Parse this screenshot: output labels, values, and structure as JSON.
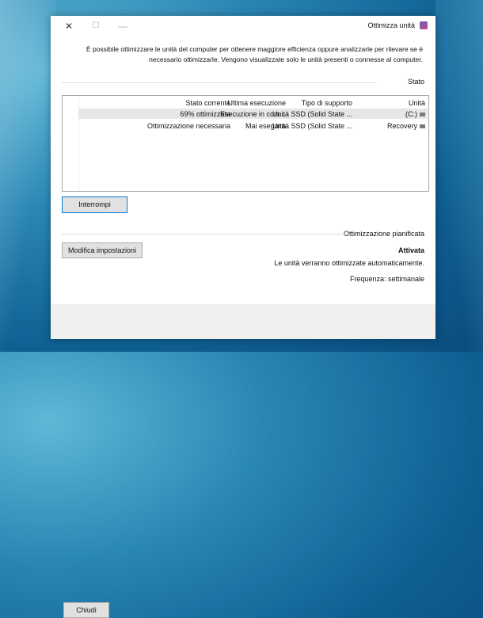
{
  "window": {
    "title": "Ottimizza unità",
    "description": "È possibile ottimizzare le unità del computer per ottenere maggiore efficienza oppure analizzarle per rilevare se è necessario ottimizzarle. Vengono visualizzate solo le unità presenti o connesse al computer."
  },
  "status_section": {
    "label": "Stato",
    "columns": [
      "Unità",
      "Tipo di supporto",
      "Ultima esecuzione",
      "Stato corrente"
    ],
    "rows": [
      {
        "unit": "(C:)",
        "type": "Unità SSD (Solid State ...",
        "last_run": "Esecuzione in cors...",
        "state": "69% ottimizzata"
      },
      {
        "unit": "Recovery",
        "type": "Unità SSD (Solid State ...",
        "last_run": "Mai eseguita",
        "state": "Ottimizzazione necessaria"
      }
    ],
    "stop_button": "Interrompi"
  },
  "scheduled": {
    "label": "Ottimizzazione pianificata",
    "status": "Attivata",
    "description": "Le unità verranno ottimizzate automaticamente.",
    "frequency": "Frequenza: settimanale",
    "settings_button": "Modifica impostazioni"
  },
  "footer": {
    "close_button": "Chiudi"
  },
  "icons": {
    "close": "close-icon",
    "maximize": "maximize-icon",
    "minimize": "minimize-icon",
    "app": "defrag-app-icon",
    "drive": "drive-icon"
  }
}
